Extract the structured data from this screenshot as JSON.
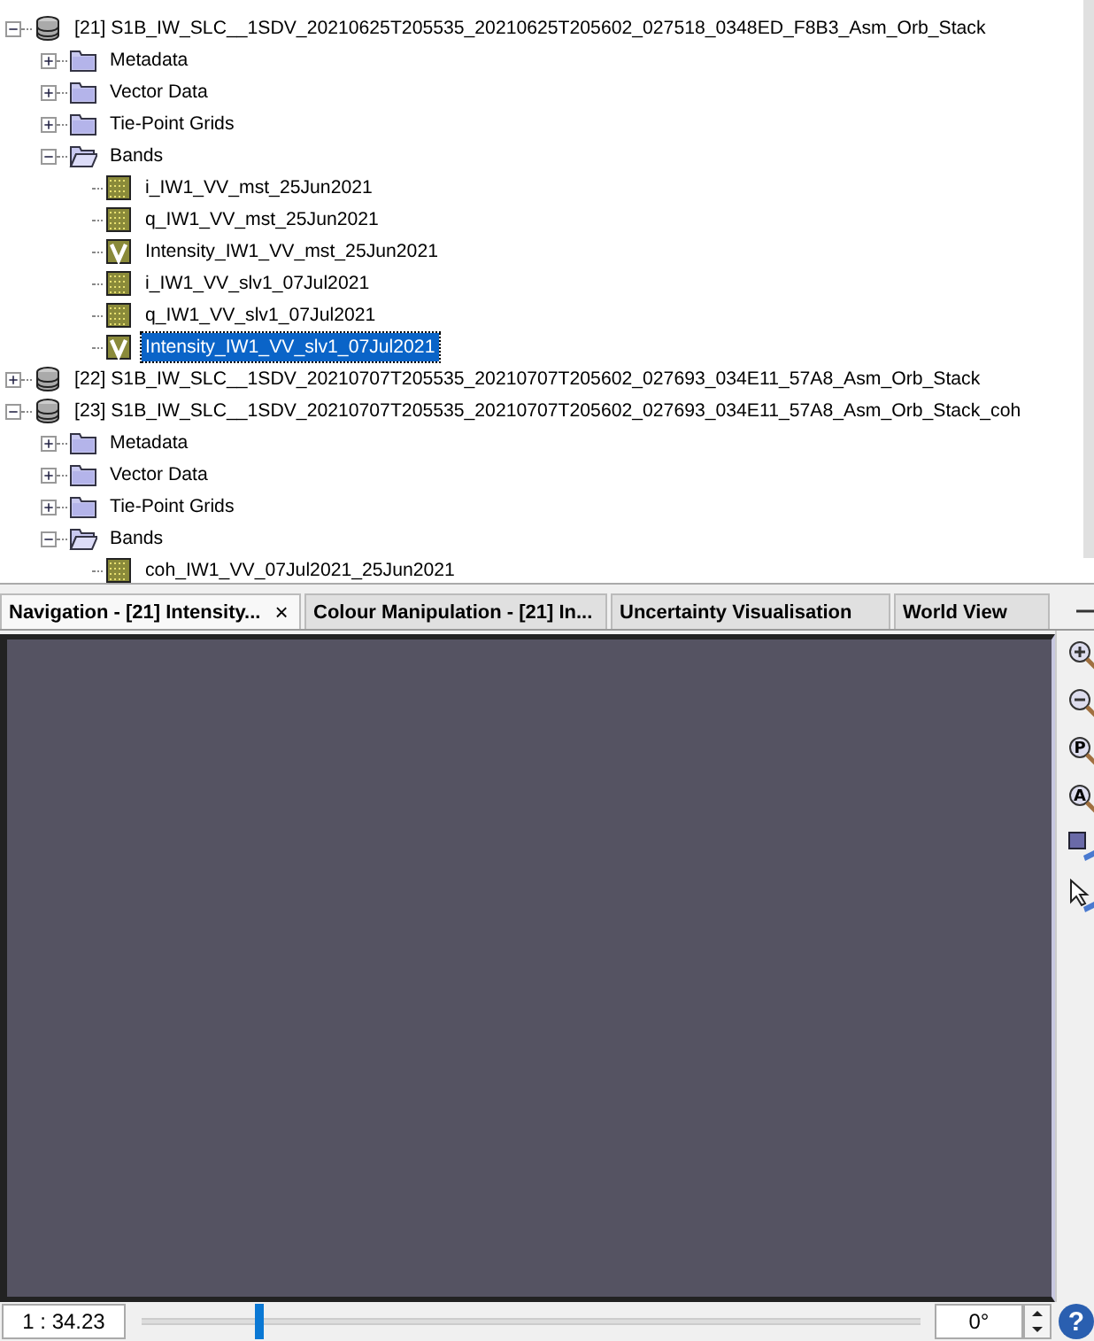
{
  "tree": [
    {
      "label": "[21] S1B_IW_SLC__1SDV_20210625T205535_20210625T205602_027518_0348ED_F8B3_Asm_Orb_Stack",
      "kind": "product",
      "expanded": true,
      "selected": false,
      "children": [
        {
          "label": "Metadata",
          "kind": "folder",
          "expanded": false,
          "selected": false
        },
        {
          "label": "Vector Data",
          "kind": "folder",
          "expanded": false,
          "selected": false
        },
        {
          "label": "Tie-Point Grids",
          "kind": "folder",
          "expanded": false,
          "selected": false
        },
        {
          "label": "Bands",
          "kind": "folder",
          "expanded": true,
          "selected": false,
          "children": [
            {
              "label": "i_IW1_VV_mst_25Jun2021",
              "kind": "band",
              "selected": false
            },
            {
              "label": "q_IW1_VV_mst_25Jun2021",
              "kind": "band",
              "selected": false
            },
            {
              "label": "Intensity_IW1_VV_mst_25Jun2021",
              "kind": "virtual",
              "selected": false
            },
            {
              "label": "i_IW1_VV_slv1_07Jul2021",
              "kind": "band",
              "selected": false
            },
            {
              "label": "q_IW1_VV_slv1_07Jul2021",
              "kind": "band",
              "selected": false
            },
            {
              "label": "Intensity_IW1_VV_slv1_07Jul2021",
              "kind": "virtual",
              "selected": true
            }
          ]
        }
      ]
    },
    {
      "label": "[22] S1B_IW_SLC__1SDV_20210707T205535_20210707T205602_027693_034E11_57A8_Asm_Orb_Stack",
      "kind": "product",
      "expanded": false,
      "selected": false
    },
    {
      "label": "[23] S1B_IW_SLC__1SDV_20210707T205535_20210707T205602_027693_034E11_57A8_Asm_Orb_Stack_coh",
      "kind": "product",
      "expanded": true,
      "selected": false,
      "children": [
        {
          "label": "Metadata",
          "kind": "folder",
          "expanded": false,
          "selected": false
        },
        {
          "label": "Vector Data",
          "kind": "folder",
          "expanded": false,
          "selected": false
        },
        {
          "label": "Tie-Point Grids",
          "kind": "folder",
          "expanded": false,
          "selected": false
        },
        {
          "label": "Bands",
          "kind": "folder",
          "expanded": true,
          "selected": false,
          "children": [
            {
              "label": "coh_IW1_VV_07Jul2021_25Jun2021",
              "kind": "band",
              "selected": false
            }
          ]
        }
      ]
    }
  ],
  "tabs": [
    {
      "label": "Navigation - [21] Intensity...",
      "selected": true,
      "close": "×"
    },
    {
      "label": "Colour Manipulation - [21] In...",
      "selected": false
    },
    {
      "label": "Uncertainty Visualisation",
      "selected": false
    },
    {
      "label": "World View",
      "selected": false
    }
  ],
  "tools": [
    {
      "kind": "zoom-in"
    },
    {
      "kind": "zoom-out"
    },
    {
      "kind": "zoom-letter",
      "letter": "P"
    },
    {
      "kind": "zoom-letter",
      "letter": "A"
    },
    {
      "kind": "sync-views"
    },
    {
      "kind": "sync-cursor"
    }
  ],
  "scale": "1 : 34.23",
  "zoom_slider": {
    "level": 0.145
  },
  "rotation": "0°",
  "help": "?"
}
